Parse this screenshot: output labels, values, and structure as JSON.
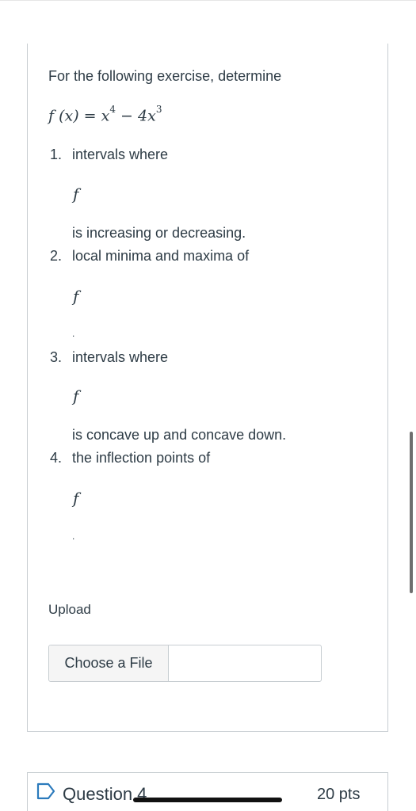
{
  "question": {
    "prompt": "For the following exercise, determine",
    "formula": {
      "lhs": "f (x) =",
      "term1_base": "x",
      "term1_exp": "4",
      "minus": "−",
      "term2_coef_base": "4x",
      "term2_exp": "3"
    },
    "items": [
      {
        "number": "1.",
        "text_before": "intervals where",
        "symbol": "f",
        "text_after": "is increasing or decreasing."
      },
      {
        "number": "2.",
        "text_before": "local minima and maxima of",
        "symbol": "f",
        "text_after": "."
      },
      {
        "number": "3.",
        "text_before": "intervals where",
        "symbol": "f",
        "text_after": "is concave up and concave down."
      },
      {
        "number": "4.",
        "text_before": "the inflection points of",
        "symbol": "f",
        "text_after": "."
      }
    ]
  },
  "upload": {
    "label": "Upload",
    "choose_button": "Choose a File",
    "selected_file": ""
  },
  "next_question": {
    "title": "Question 4",
    "points": "20 pts",
    "flag_icon": "flag-outline-icon"
  },
  "colors": {
    "text": "#2d3b45",
    "border": "#c7cdd1",
    "flag": "#2b7abc"
  }
}
